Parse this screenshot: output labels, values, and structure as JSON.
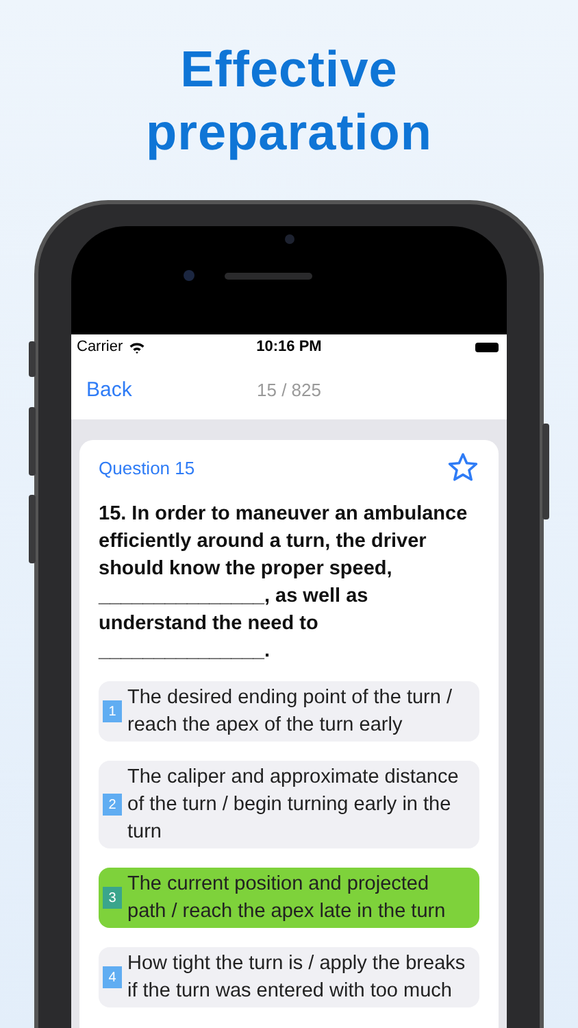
{
  "headline": [
    "Effective",
    "preparation"
  ],
  "status_bar": {
    "carrier": "Carrier",
    "time": "10:16 PM"
  },
  "nav": {
    "back": "Back",
    "title": "15 / 825"
  },
  "question": {
    "label": "Question 15",
    "starred": false,
    "text": "15. In order to maneuver an ambulance efficiently around a turn, the driver should know the proper speed, _______________, as well as understand the need to _______________."
  },
  "options": [
    {
      "number": "1",
      "text": "The desired ending point of the turn / reach the apex of the turn early",
      "selected": false
    },
    {
      "number": "2",
      "text": "The caliper and approximate distance of the turn / begin turning early in the turn",
      "selected": false
    },
    {
      "number": "3",
      "text": "The current position and projected path / reach the apex late in the turn",
      "selected": true
    },
    {
      "number": "4",
      "text": "How tight the turn is / apply the breaks if the turn was entered with too much",
      "selected": false
    }
  ]
}
